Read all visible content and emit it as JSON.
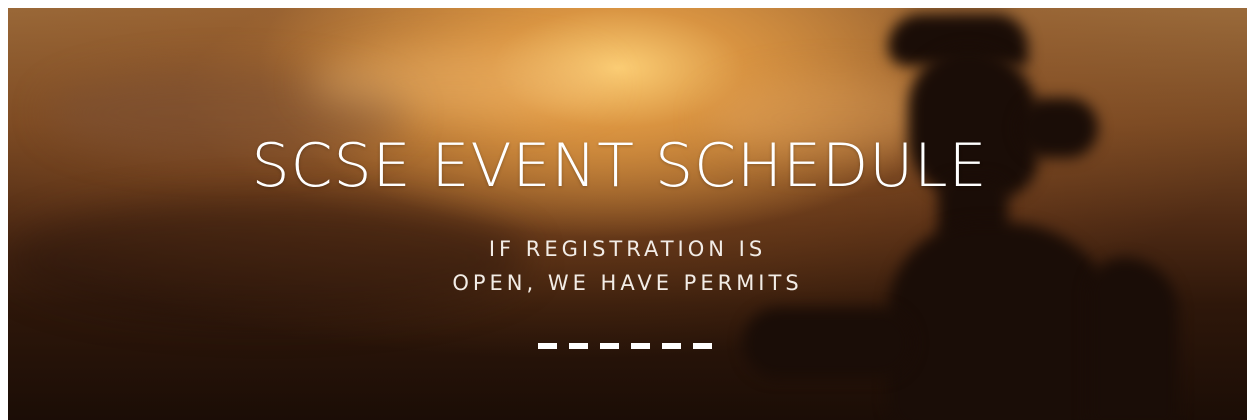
{
  "hero": {
    "title": "SCSE EVENT SCHEDULE",
    "subtitle_line1": "IF REGISTRATION IS",
    "subtitle_line2": "OPEN, WE HAVE PERMITS",
    "divider_dash_count": 6
  },
  "colors": {
    "text": "#ffffff",
    "sky_glow": "#e8a046",
    "silhouette": "#1a0d07"
  }
}
